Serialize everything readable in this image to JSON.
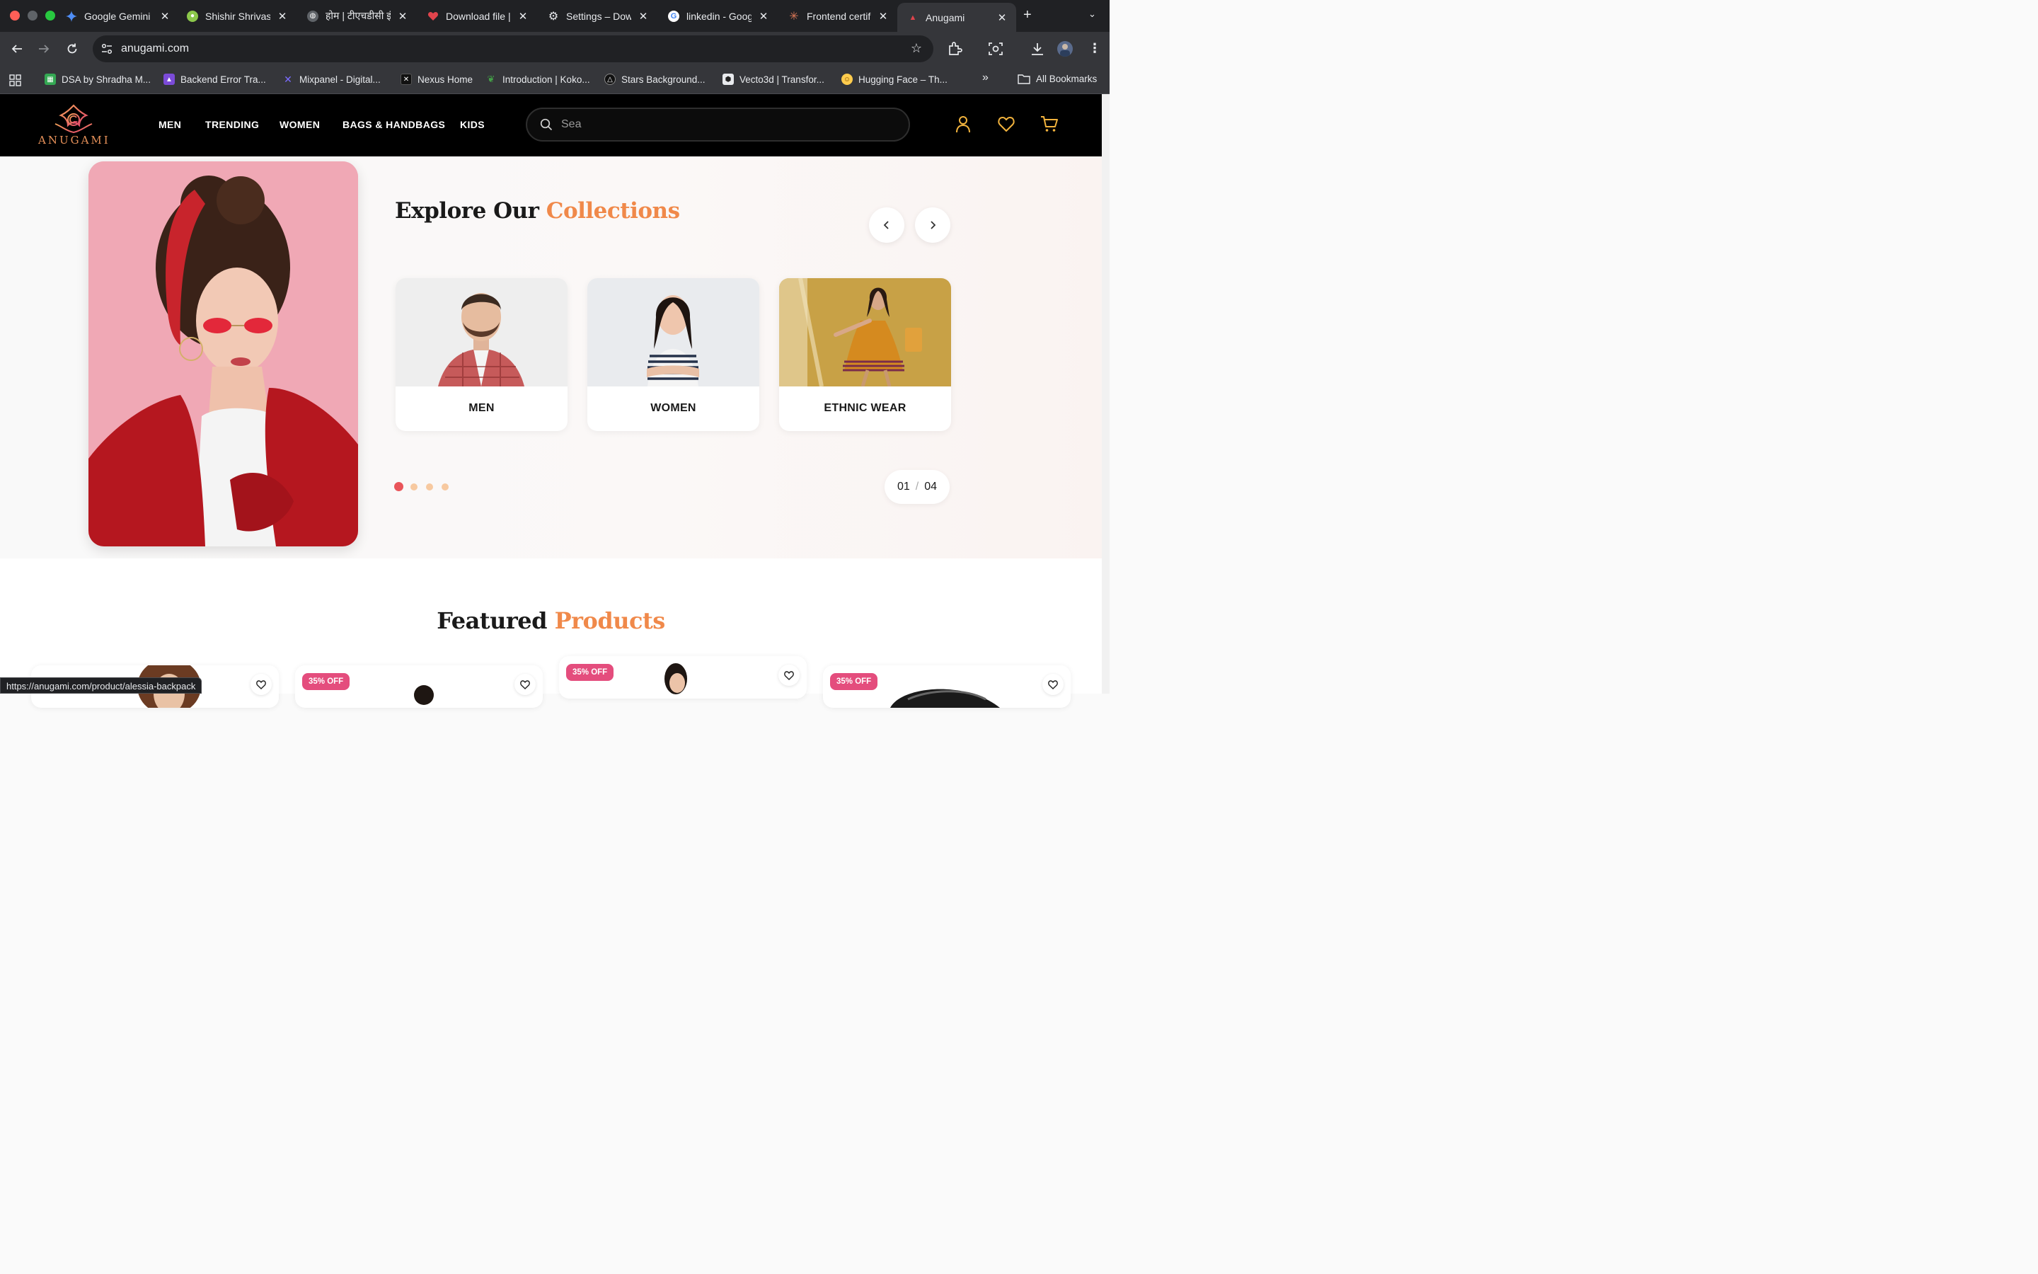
{
  "browser": {
    "tabs": [
      {
        "title": "Google Gemini",
        "icon": "gemini-icon",
        "color": "#4f8ef7"
      },
      {
        "title": "Shishir Shrivas",
        "icon": "node-icon",
        "color": "#8cc84b"
      },
      {
        "title": "होम | टीएचडीसी इं",
        "icon": "globe-icon",
        "color": "#9aa0a6"
      },
      {
        "title": "Download file |",
        "icon": "heart-icon",
        "color": "#e0444c"
      },
      {
        "title": "Settings – Dow",
        "icon": "gear-icon",
        "color": "#e8eaed"
      },
      {
        "title": "linkedin - Goog",
        "icon": "google-icon",
        "color": "#4285f4"
      },
      {
        "title": "Frontend certif",
        "icon": "spark-icon",
        "color": "#d97757"
      },
      {
        "title": "Anugami",
        "icon": "anugami-icon",
        "color": "#e0444c"
      }
    ],
    "url": "anugami.com",
    "bookmarks": [
      {
        "label": "DSA by Shradha M...",
        "color": "#34a853"
      },
      {
        "label": "Backend Error Tra...",
        "color": "#7b4bd8"
      },
      {
        "label": "Mixpanel - Digital...",
        "color": "#6a5cff"
      },
      {
        "label": "Nexus Home",
        "color": "#111111"
      },
      {
        "label": "Introduction | Koko...",
        "color": "#2e7d32"
      },
      {
        "label": "Stars Background...",
        "color": "#111111"
      },
      {
        "label": "Vecto3d | Transfor...",
        "color": "#dddddd"
      },
      {
        "label": "Hugging Face – Th...",
        "color": "#ffcc4d"
      }
    ],
    "bookmarks_overflow": "»",
    "all_bookmarks": "All Bookmarks",
    "status_url": "https://anugami.com/product/alessia-backpack"
  },
  "site": {
    "logo_text": "ANUGAMI",
    "nav": [
      "MEN",
      "TRENDING",
      "WOMEN",
      "BAGS & HANDBAGS",
      "KIDS"
    ],
    "search_placeholder": "Sea",
    "accent_color": "#f0894a",
    "icon_color": "#f2b33d"
  },
  "collections": {
    "title_main": "Explore Our ",
    "title_accent": "Collections",
    "cards": [
      {
        "label": "MEN"
      },
      {
        "label": "WOMEN"
      },
      {
        "label": "ETHNIC WEAR"
      }
    ],
    "slide_current": "01",
    "slide_sep": "/",
    "slide_total": "04",
    "dots": 4,
    "active_dot": 0
  },
  "featured": {
    "title_main": "Featured ",
    "title_accent": "Products",
    "products": [
      {
        "badge": ""
      },
      {
        "badge": "35% OFF"
      },
      {
        "badge": "35% OFF"
      },
      {
        "badge": "35% OFF"
      }
    ]
  }
}
